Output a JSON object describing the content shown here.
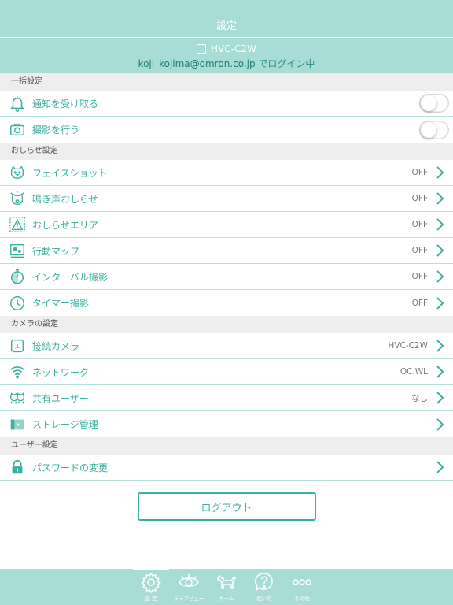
{
  "header": {
    "title": "設定",
    "device_name": "HVC-C2W",
    "email": "koji_kojima@omron.co.jp",
    "login_suffix": " でログイン中"
  },
  "sections": {
    "bulk": "一括設定",
    "notify": "おしらせ設定",
    "camera": "カメラの設定",
    "user": "ユーザー設定"
  },
  "bulk_rows": [
    {
      "label": "通知を受け取る",
      "icon": "bell-icon",
      "toggle": false
    },
    {
      "label": "撮影を行う",
      "icon": "camera-icon",
      "toggle": false
    }
  ],
  "notify_rows": [
    {
      "label": "フェイスショット",
      "icon": "face-icon",
      "value": "OFF"
    },
    {
      "label": "鳴き声おしらせ",
      "icon": "bark-icon",
      "value": "OFF"
    },
    {
      "label": "おしらせエリア",
      "icon": "area-warning-icon",
      "value": "OFF"
    },
    {
      "label": "行動マップ",
      "icon": "map-icon",
      "value": "OFF"
    },
    {
      "label": "インターバル撮影",
      "icon": "stopwatch-icon",
      "value": "OFF"
    },
    {
      "label": "タイマー撮影",
      "icon": "clock-icon",
      "value": "OFF"
    }
  ],
  "camera_rows": [
    {
      "label": "接続カメラ",
      "icon": "connected-camera-icon",
      "value": "HVC-C2W"
    },
    {
      "label": "ネットワーク",
      "icon": "wifi-icon",
      "value": "OC.WL"
    },
    {
      "label": "共有ユーザー",
      "icon": "shared-users-icon",
      "value": "なし"
    },
    {
      "label": "ストレージ管理",
      "icon": "storage-icon",
      "value": ""
    }
  ],
  "user_rows": [
    {
      "label": "パスワードの変更",
      "icon": "lock-icon",
      "value": ""
    }
  ],
  "logout_label": "ログアウト",
  "tabs": [
    {
      "label": "設 定",
      "icon": "gear-icon",
      "active": true
    },
    {
      "label": "ライブビュー",
      "icon": "eye-icon",
      "active": false
    },
    {
      "label": "ホーム",
      "icon": "dog-icon",
      "active": false
    },
    {
      "label": "使い方",
      "icon": "help-icon",
      "active": false
    },
    {
      "label": "その他",
      "icon": "more-icon",
      "active": false
    }
  ],
  "colors": {
    "accent": "#3ab0a0",
    "header_bg": "#a7ddd6",
    "section_bg": "#eeeeee",
    "email": "#1f7c70"
  }
}
